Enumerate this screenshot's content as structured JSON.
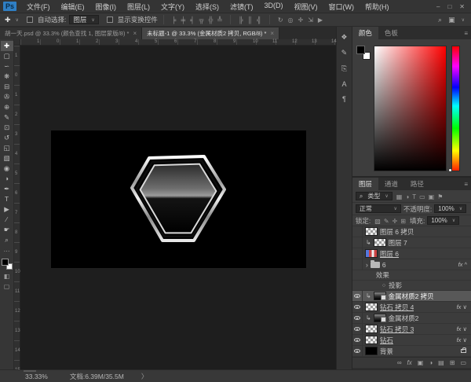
{
  "colors": {
    "ps_logo_blue": "#2f7fc4",
    "panel_bg": "#383838",
    "canvas_bg": "#1e1e1e",
    "document_bg": "#000000",
    "selected_row": "#585858",
    "diamond_outline": "#e8e8e8",
    "diamond_fill_top": "#2a2a2a",
    "diamond_fill_mid": "#9b9b9b",
    "diamond_fill_bottom": "#000000"
  },
  "titlebar": {
    "logo": "Ps",
    "menus": [
      {
        "name": "menu-file",
        "label": "文件(F)"
      },
      {
        "name": "menu-edit",
        "label": "编辑(E)"
      },
      {
        "name": "menu-image",
        "label": "图像(I)"
      },
      {
        "name": "menu-layer",
        "label": "图层(L)"
      },
      {
        "name": "menu-type",
        "label": "文字(Y)"
      },
      {
        "name": "menu-select",
        "label": "选择(S)"
      },
      {
        "name": "menu-filter",
        "label": "滤镜(T)"
      },
      {
        "name": "menu-3d",
        "label": "3D(D)"
      },
      {
        "name": "menu-view",
        "label": "视图(V)"
      },
      {
        "name": "menu-window",
        "label": "窗口(W)"
      },
      {
        "name": "menu-help",
        "label": "帮助(H)"
      }
    ],
    "controls": {
      "minimize": "–",
      "maximize": "□",
      "close": "✕"
    }
  },
  "options_bar": {
    "tool_icon": "✚",
    "tool_caret": "∨",
    "auto_select_label": "自动选择:",
    "auto_select_value": "图层",
    "dropdown_caret": "∨",
    "show_transform_label": "显示变换控件",
    "align_icons": [
      {
        "name": "align-left-edges-icon",
        "glyph": "╞"
      },
      {
        "name": "align-horizontal-centers-icon",
        "glyph": "╪"
      },
      {
        "name": "align-right-edges-icon",
        "glyph": "╡"
      },
      {
        "name": "align-top-edges-icon",
        "glyph": "╦"
      },
      {
        "name": "align-vertical-centers-icon",
        "glyph": "╬"
      },
      {
        "name": "align-bottom-edges-icon",
        "glyph": "╩"
      }
    ],
    "distribute_icons": [
      {
        "name": "distribute-left-icon",
        "glyph": "╠"
      },
      {
        "name": "distribute-center-icon",
        "glyph": "║"
      },
      {
        "name": "distribute-right-icon",
        "glyph": "╣"
      }
    ],
    "threed_icons": [
      {
        "name": "3d-rotate-icon",
        "glyph": "↻"
      },
      {
        "name": "3d-roll-icon",
        "glyph": "◎"
      },
      {
        "name": "3d-drag-icon",
        "glyph": "✛"
      },
      {
        "name": "3d-slide-icon",
        "glyph": "⇲"
      },
      {
        "name": "3d-scale-icon",
        "glyph": "▶"
      }
    ],
    "search_icon": "⌕",
    "workspace_icon": "▣",
    "workspace_caret": "∨"
  },
  "tabs": [
    {
      "title": "胡一天.psd @ 33.3% (颜色查找 1, 图层蒙版/8) *",
      "close": "×",
      "active": false
    },
    {
      "title": "未标题-1 @ 33.3% (金属材质2 拷贝, RGB/8) *",
      "close": "×",
      "active": true
    }
  ],
  "toolbar": {
    "tools": [
      {
        "name": "move-tool",
        "glyph": "✚",
        "selected": true
      },
      {
        "name": "marquee-tool",
        "glyph": "▢"
      },
      {
        "name": "lasso-tool",
        "glyph": "∽"
      },
      {
        "name": "quick-selection-tool",
        "glyph": "❋"
      },
      {
        "name": "crop-tool",
        "glyph": "⊟"
      },
      {
        "name": "eyedropper-tool",
        "glyph": "✇"
      },
      {
        "name": "healing-brush-tool",
        "glyph": "⊕"
      },
      {
        "name": "brush-tool",
        "glyph": "✎"
      },
      {
        "name": "clone-stamp-tool",
        "glyph": "⊡"
      },
      {
        "name": "history-brush-tool",
        "glyph": "↺"
      },
      {
        "name": "eraser-tool",
        "glyph": "◱"
      },
      {
        "name": "gradient-tool",
        "glyph": "▧"
      },
      {
        "name": "blur-tool",
        "glyph": "◉"
      },
      {
        "name": "dodge-tool",
        "glyph": "◑"
      },
      {
        "name": "pen-tool",
        "glyph": "✒"
      },
      {
        "name": "type-tool",
        "glyph": "T"
      },
      {
        "name": "path-selection-tool",
        "glyph": "▶"
      },
      {
        "name": "line-tool",
        "glyph": "∕"
      },
      {
        "name": "hand-tool",
        "glyph": "☛"
      },
      {
        "name": "zoom-tool",
        "glyph": "⌕"
      }
    ],
    "ellipsis": "⋯",
    "foreground_color": "#000000",
    "background_color": "#ffffff",
    "quick_mask_icon": "◧",
    "screen_mode_icon": "▢"
  },
  "rulers": {
    "h_labels": [
      "1",
      "0",
      "1",
      "2",
      "3",
      "4",
      "5",
      "6",
      "7",
      "8",
      "9",
      "10",
      "11",
      "12",
      "13",
      "14"
    ],
    "v_labels": [
      "1",
      "0",
      "1",
      "2",
      "3",
      "4",
      "5",
      "6",
      "7",
      "8",
      "9",
      "10",
      "11",
      "12",
      "13",
      "14",
      "15"
    ]
  },
  "right_strip": {
    "icons": [
      {
        "name": "styles-panel-icon",
        "glyph": "❖"
      },
      {
        "name": "brush-panel-icon",
        "glyph": "✎"
      },
      {
        "name": "clone-source-panel-icon",
        "glyph": "⎘"
      },
      {
        "name": "character-panel-icon",
        "glyph": "A"
      },
      {
        "name": "paragraph-panel-icon",
        "glyph": "¶"
      }
    ]
  },
  "color_panel": {
    "tabs": {
      "color": "颜色",
      "swatches": "色板"
    },
    "menu_icon": "≡",
    "foreground": "#000000",
    "background": "#ffffff",
    "hue_bar_top_to_bottom": [
      "#ff0000",
      "#ff00ff",
      "#0000ff",
      "#00ffff",
      "#00ff00",
      "#ffff00",
      "#ff2000"
    ]
  },
  "layers_panel": {
    "tabs": {
      "layers": "图层",
      "channels": "通道",
      "paths": "路径"
    },
    "menu_icon": "≡",
    "filter": {
      "search_icon": "⌕",
      "kind_label": "类型",
      "caret": "∨",
      "icons": [
        {
          "name": "filter-pixel-layers-icon",
          "glyph": "▦"
        },
        {
          "name": "filter-adjustment-layers-icon",
          "glyph": "◑"
        },
        {
          "name": "filter-type-layers-icon",
          "glyph": "T"
        },
        {
          "name": "filter-shape-layers-icon",
          "glyph": "▭"
        },
        {
          "name": "filter-smart-objects-icon",
          "glyph": "▣"
        },
        {
          "name": "filter-toggle-icon",
          "glyph": "⚑"
        }
      ]
    },
    "blend_mode": "正常",
    "blend_caret": "∨",
    "opacity_label": "不透明度:",
    "opacity_value": "100%",
    "lock_label": "锁定:",
    "lock_icons": [
      {
        "name": "lock-transparency-icon",
        "glyph": "▨"
      },
      {
        "name": "lock-image-icon",
        "glyph": "✎"
      },
      {
        "name": "lock-position-icon",
        "glyph": "✛"
      },
      {
        "name": "lock-artboard-icon",
        "glyph": "⊞"
      }
    ],
    "fill_label": "填充:",
    "fill_value": "100%",
    "rows": [
      {
        "name": "图层 6 拷贝",
        "visible": false,
        "thumb": "checker",
        "badge": ""
      },
      {
        "name": "图层 7",
        "visible": false,
        "clipped": true,
        "clip": "↳",
        "thumb": "checker",
        "badge": ""
      },
      {
        "name": "图层 6",
        "visible": false,
        "thumb": "color",
        "badge": ""
      },
      {
        "name": "6",
        "visible": false,
        "group": true,
        "caret": "›",
        "thumb": "folder",
        "badge": "fx ^"
      },
      {
        "name": "效果",
        "type": "effects-header"
      },
      {
        "name": "投影",
        "type": "effect-item",
        "bullet": "○"
      },
      {
        "name": "金属材质2 拷贝",
        "visible": true,
        "clipped": true,
        "clip": "↳",
        "thumb": "metal",
        "selected": true,
        "badge": ""
      },
      {
        "name": "钻石 拷贝 4",
        "visible": true,
        "thumb": "checker",
        "badge": "fx ∨"
      },
      {
        "name": "金属材质2",
        "visible": true,
        "clipped": true,
        "clip": "↳",
        "thumb": "metal",
        "badge": ""
      },
      {
        "name": "钻石 拷贝 3",
        "visible": true,
        "thumb": "checker",
        "badge": "fx ∨"
      },
      {
        "name": "钻石",
        "visible": true,
        "thumb": "checker",
        "badge": "fx ∨"
      },
      {
        "name": "背景",
        "visible": true,
        "thumb": "black",
        "locked": true,
        "badge": ""
      }
    ],
    "bottom_icons": [
      {
        "name": "link-layers-icon",
        "glyph": "∞"
      },
      {
        "name": "layer-style-icon",
        "glyph": "fx"
      },
      {
        "name": "add-layer-mask-icon",
        "glyph": "▣"
      },
      {
        "name": "adjustment-layer-icon",
        "glyph": "◑"
      },
      {
        "name": "layer-group-icon",
        "glyph": "▤"
      },
      {
        "name": "new-layer-icon",
        "glyph": "⊞"
      },
      {
        "name": "delete-layer-icon",
        "glyph": "▭"
      }
    ]
  },
  "status_bar": {
    "zoom_level": "33.33%",
    "document_info": "文档:6.39M/35.5M",
    "arrow": "〉"
  }
}
